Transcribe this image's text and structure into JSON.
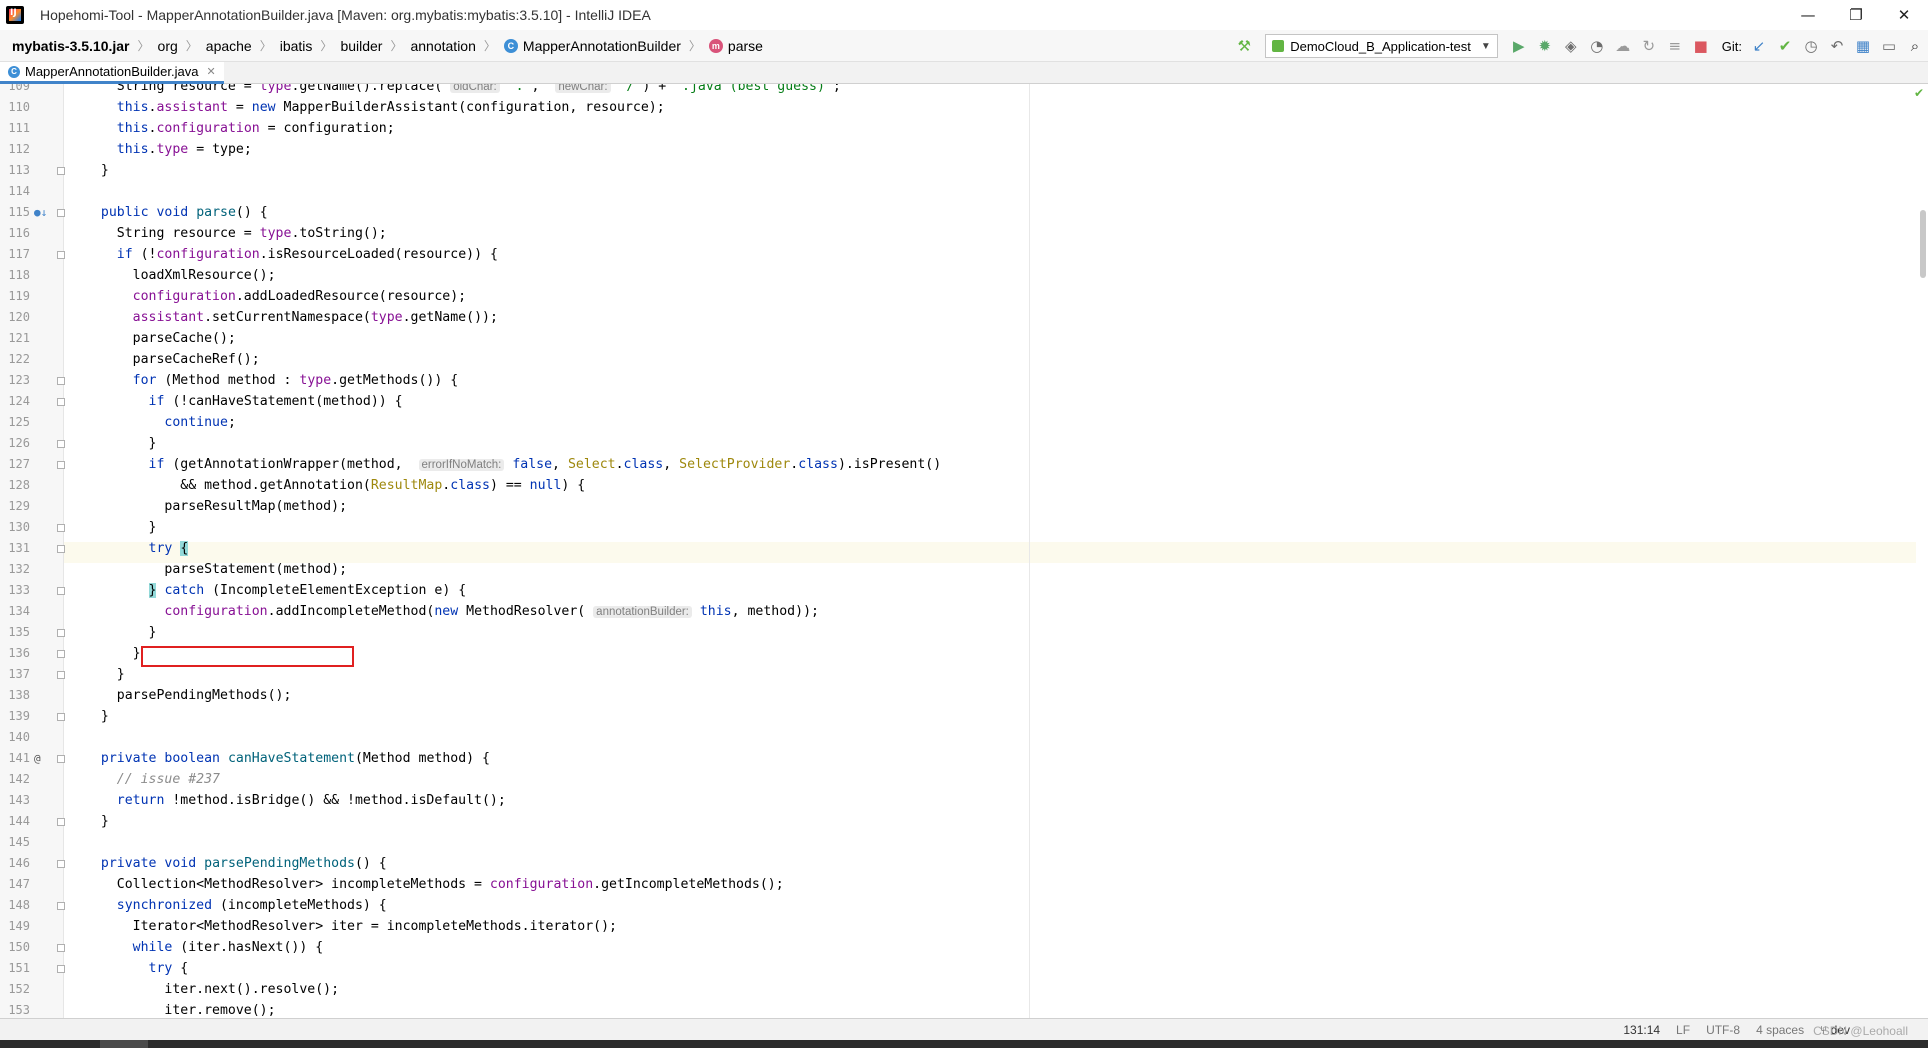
{
  "window": {
    "title": "Hopehomi-Tool - MapperAnnotationBuilder.java [Maven: org.mybatis:mybatis:3.5.10] - IntelliJ IDEA",
    "minimize": "—",
    "maximize": "❐",
    "close": "✕"
  },
  "breadcrumbs": {
    "jar": "mybatis-3.5.10.jar",
    "p1": "org",
    "p2": "apache",
    "p3": "ibatis",
    "p4": "builder",
    "p5": "annotation",
    "cls": "MapperAnnotationBuilder",
    "method": "parse"
  },
  "toolbar": {
    "run_config": "DemoCloud_B_Application-test",
    "git_label": "Git:"
  },
  "tab": {
    "label": "MapperAnnotationBuilder.java"
  },
  "code": {
    "l109": "109",
    "l110": "110",
    "l111": "111",
    "l112": "112",
    "l113": "113",
    "l114": "114",
    "l115": "115",
    "l116": "116",
    "l117": "117",
    "l118": "118",
    "l119": "119",
    "l120": "120",
    "l121": "121",
    "l122": "122",
    "l123": "123",
    "l124": "124",
    "l125": "125",
    "l126": "126",
    "l127": "127",
    "l128": "128",
    "l129": "129",
    "l130": "130",
    "l131": "131",
    "l132": "132",
    "l133": "133",
    "l134": "134",
    "l135": "135",
    "l136": "136",
    "l137": "137",
    "l138": "138",
    "l139": "139",
    "l140": "140",
    "l141": "141",
    "l142": "142",
    "l143": "143",
    "l144": "144",
    "l145": "145",
    "l146": "146",
    "l147": "147",
    "l148": "148",
    "l149": "149",
    "l150": "150",
    "l151": "151",
    "l152": "152",
    "l153": "153",
    "hint_oldchar": "oldChar:",
    "hint_newchar": "newChar:",
    "hint_errorifnomatch": "errorIfNoMatch:",
    "hint_annotationbuilder": "annotationBuilder:"
  },
  "status": {
    "position": "131:14",
    "line_sep": "LF",
    "encoding": "UTF-8",
    "indent": "4 spaces",
    "branch": "dev",
    "watermark": "CSDN @Leohoall"
  }
}
